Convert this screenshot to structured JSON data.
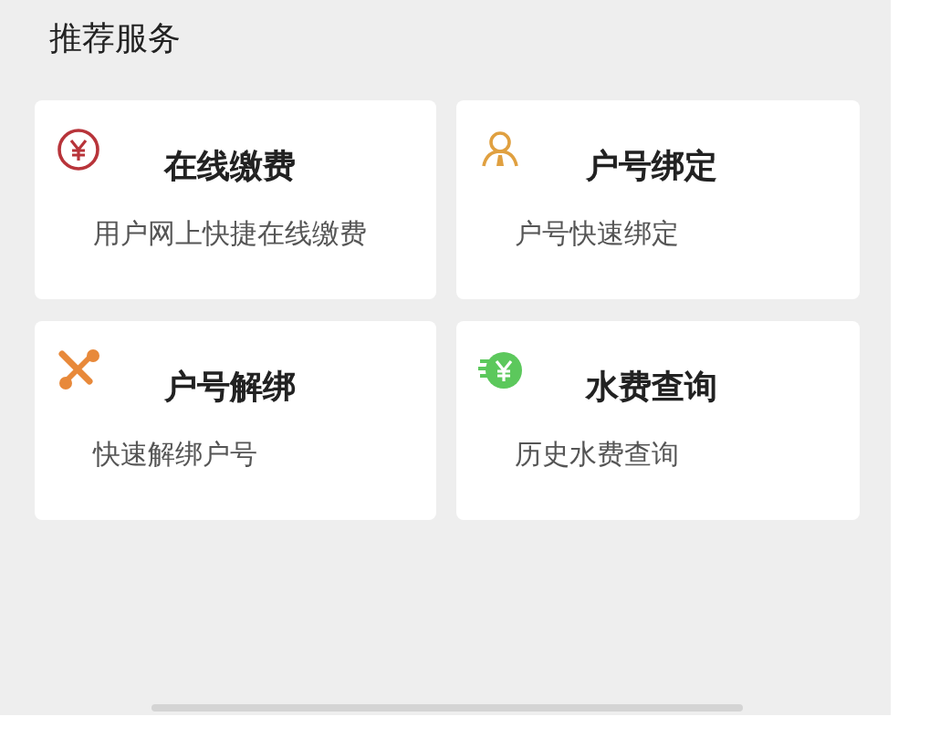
{
  "section_title": "推荐服务",
  "services": [
    {
      "title": "在线缴费",
      "subtitle": "用户网上快捷在线缴费"
    },
    {
      "title": "户号绑定",
      "subtitle": "户号快速绑定"
    },
    {
      "title": "户号解绑",
      "subtitle": "快速解绑户号"
    },
    {
      "title": "水费查询",
      "subtitle": "历史水费查询"
    }
  ]
}
